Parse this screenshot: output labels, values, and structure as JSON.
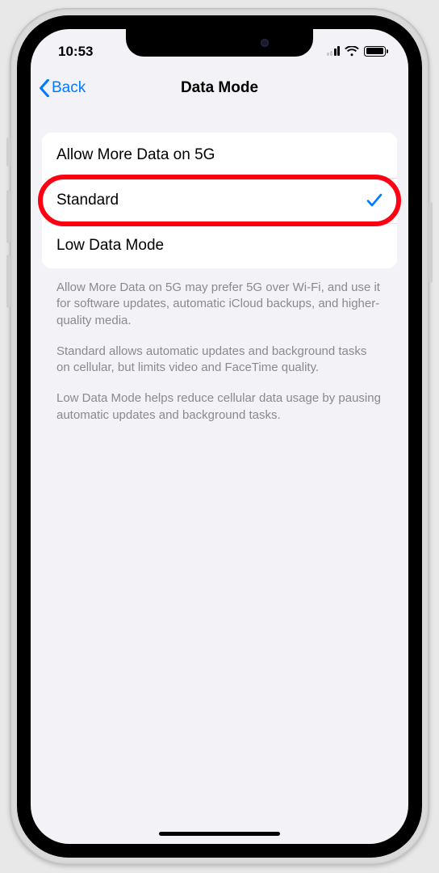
{
  "status": {
    "time": "10:53"
  },
  "nav": {
    "back": "Back",
    "title": "Data Mode"
  },
  "options": {
    "allow_more": {
      "label": "Allow More Data on 5G",
      "selected": false
    },
    "standard": {
      "label": "Standard",
      "selected": true
    },
    "low_data": {
      "label": "Low Data Mode",
      "selected": false
    }
  },
  "footer": {
    "p1": "Allow More Data on 5G may prefer 5G over Wi-Fi, and use it for software updates, automatic iCloud backups, and higher-quality media.",
    "p2": "Standard allows automatic updates and background tasks on cellular, but limits video and FaceTime quality.",
    "p3": "Low Data Mode helps reduce cellular data usage by pausing automatic updates and background tasks."
  },
  "annotation": {
    "highlighted_option": "standard"
  }
}
